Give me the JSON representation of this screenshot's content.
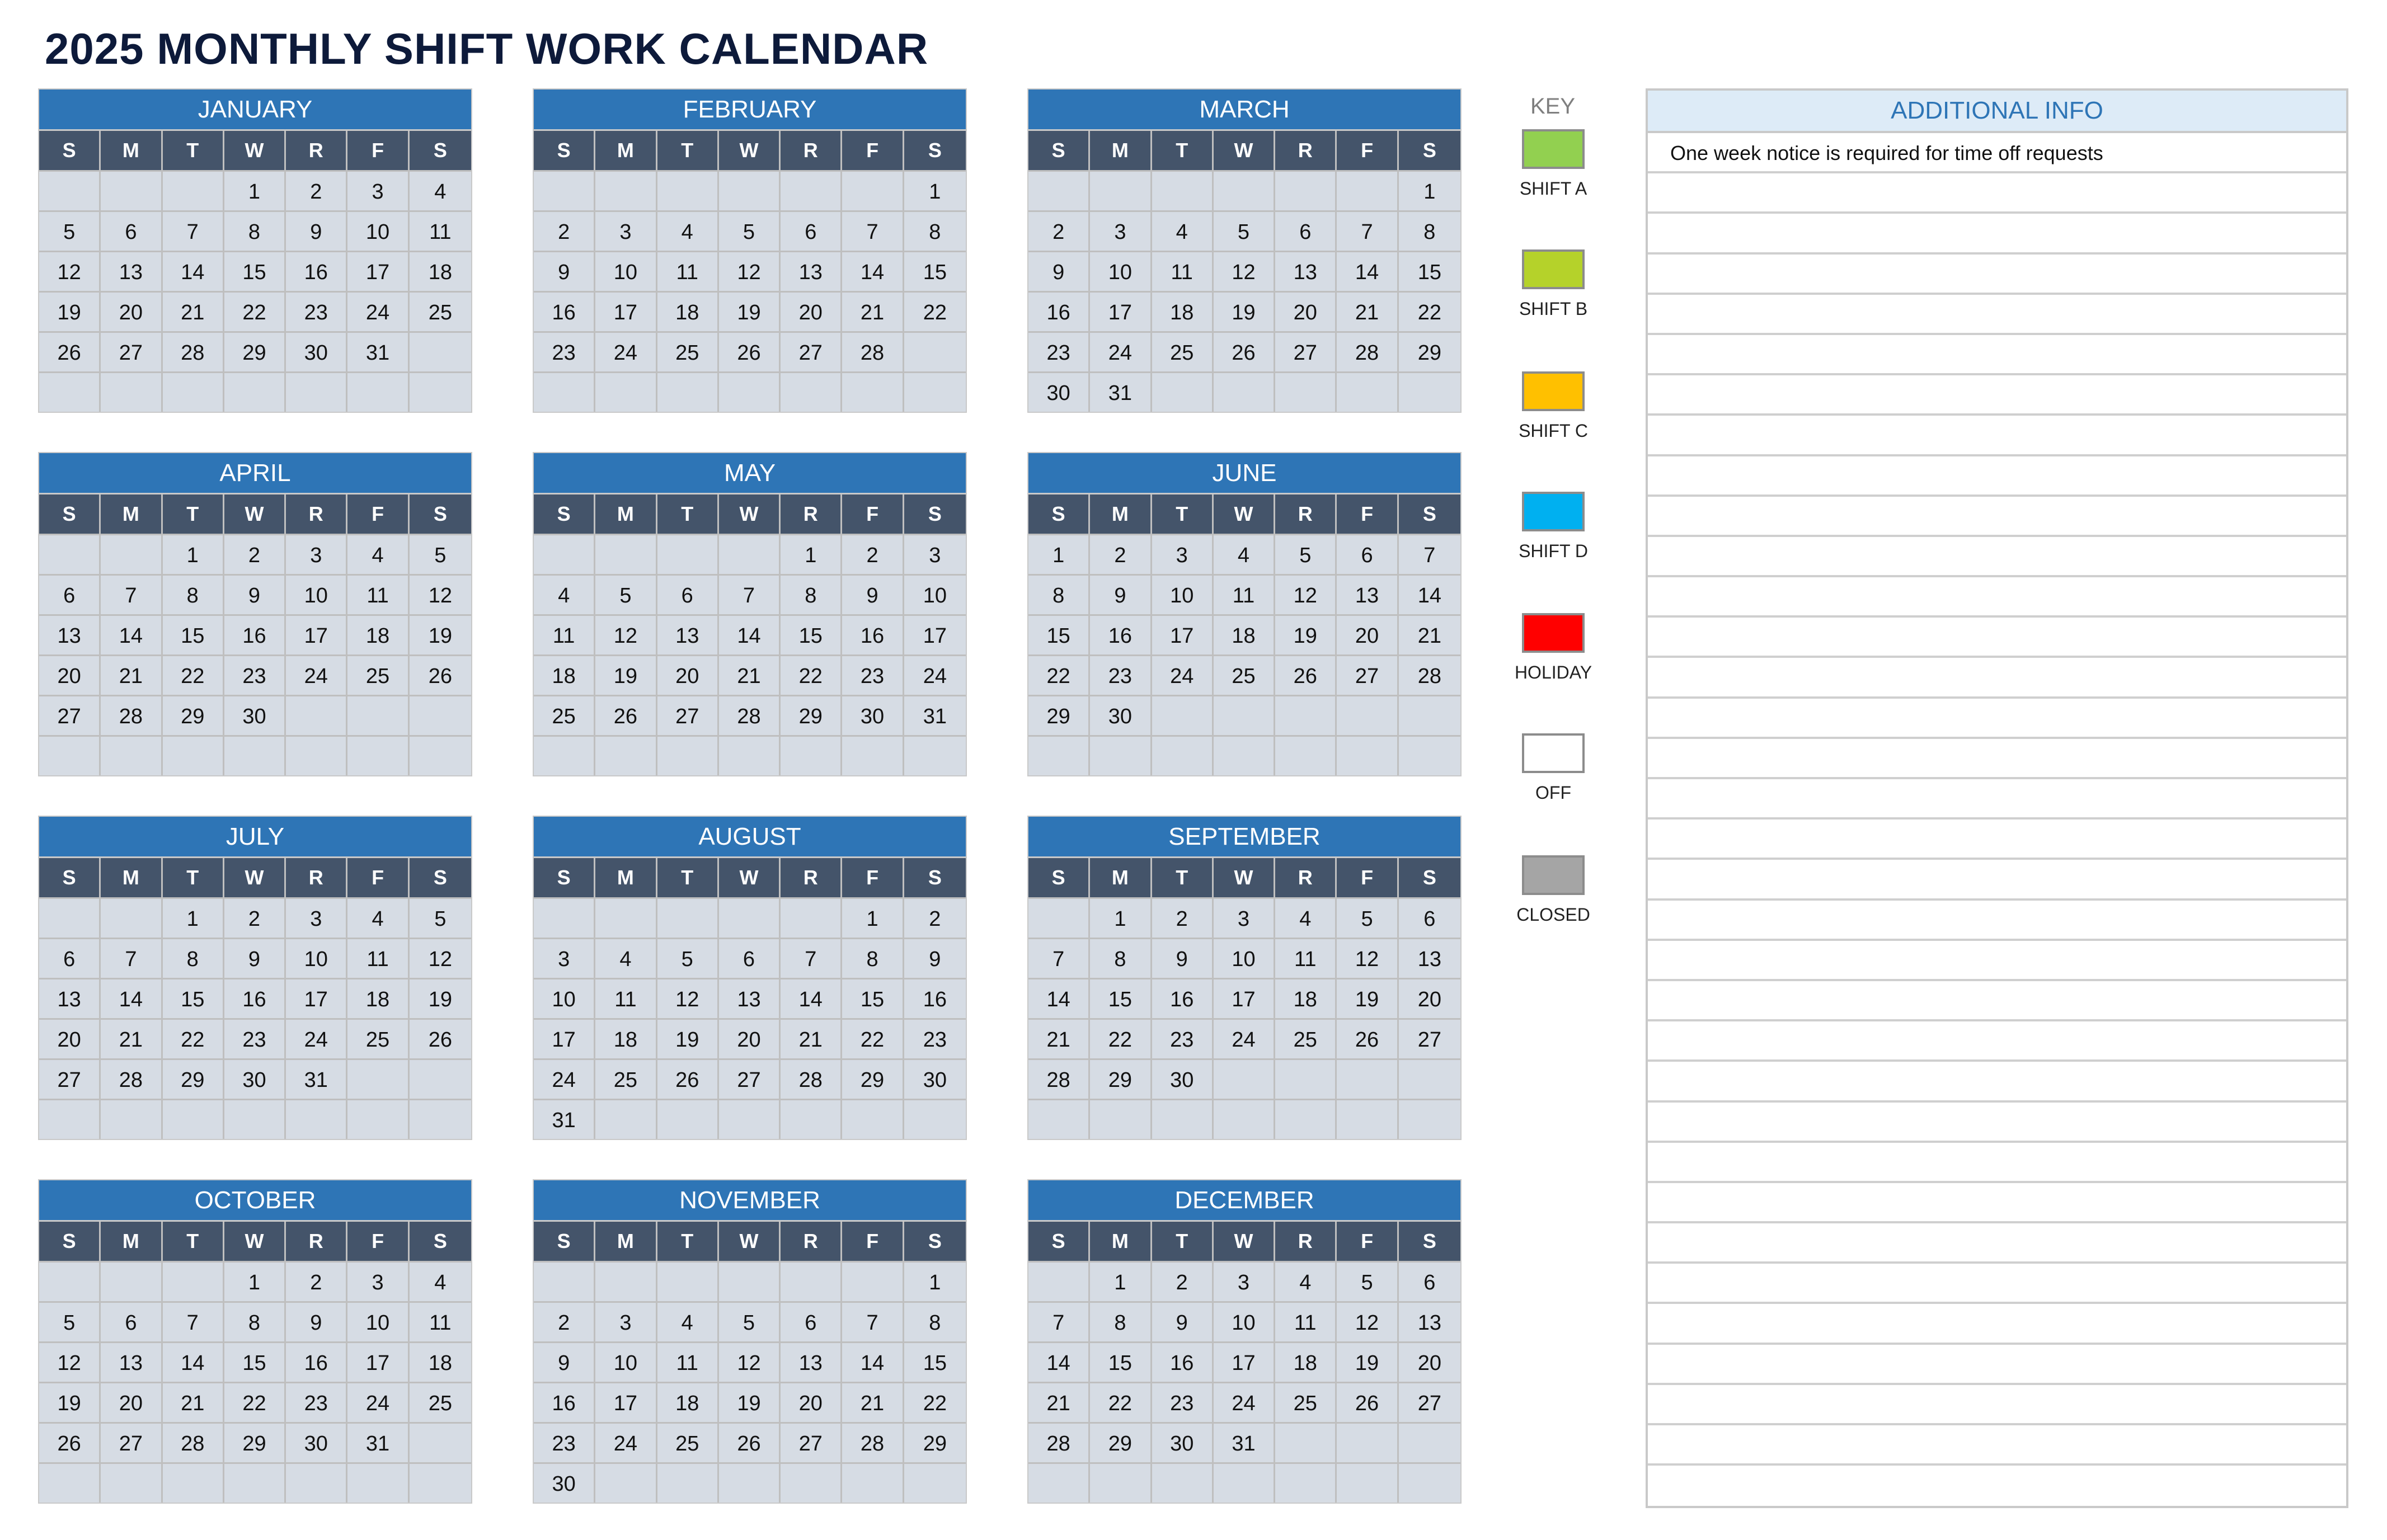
{
  "title": "2025 MONTHLY SHIFT WORK CALENDAR",
  "weekdays": [
    "S",
    "M",
    "T",
    "W",
    "R",
    "F",
    "S"
  ],
  "months": [
    {
      "name": "JANUARY",
      "start": 3,
      "days": 31
    },
    {
      "name": "FEBRUARY",
      "start": 6,
      "days": 28
    },
    {
      "name": "MARCH",
      "start": 6,
      "days": 31
    },
    {
      "name": "APRIL",
      "start": 2,
      "days": 30
    },
    {
      "name": "MAY",
      "start": 4,
      "days": 31
    },
    {
      "name": "JUNE",
      "start": 0,
      "days": 30
    },
    {
      "name": "JULY",
      "start": 2,
      "days": 31
    },
    {
      "name": "AUGUST",
      "start": 5,
      "days": 31
    },
    {
      "name": "SEPTEMBER",
      "start": 1,
      "days": 30
    },
    {
      "name": "OCTOBER",
      "start": 3,
      "days": 31
    },
    {
      "name": "NOVEMBER",
      "start": 6,
      "days": 30
    },
    {
      "name": "DECEMBER",
      "start": 1,
      "days": 31
    }
  ],
  "key": {
    "label": "KEY",
    "items": [
      {
        "label": "SHIFT A",
        "color": "#92d050"
      },
      {
        "label": "SHIFT B",
        "color": "#b5d22a"
      },
      {
        "label": "SHIFT C",
        "color": "#ffc000"
      },
      {
        "label": "SHIFT D",
        "color": "#00b0f0"
      },
      {
        "label": "HOLIDAY",
        "color": "#ff0000"
      },
      {
        "label": "OFF",
        "color": "#ffffff"
      },
      {
        "label": "CLOSED",
        "color": "#a5a5a5"
      }
    ]
  },
  "additional_info": {
    "header": "ADDITIONAL INFO",
    "rows": [
      "One week notice is required for time off requests",
      "",
      "",
      "",
      "",
      "",
      "",
      "",
      "",
      "",
      "",
      "",
      "",
      "",
      "",
      "",
      "",
      "",
      "",
      "",
      "",
      "",
      "",
      "",
      "",
      "",
      "",
      "",
      "",
      "",
      "",
      "",
      "",
      ""
    ]
  },
  "colors": {
    "month_header": "#2e75b6",
    "weekday_header": "#44546a",
    "day_cell": "#d6dce4",
    "info_header": "#ddebf7"
  }
}
